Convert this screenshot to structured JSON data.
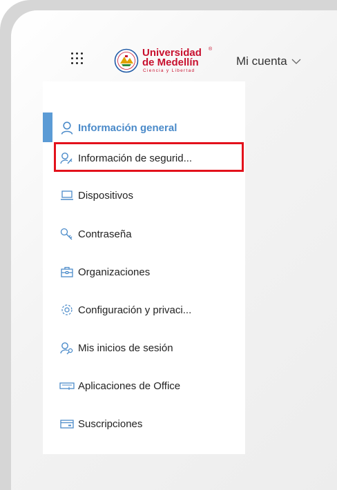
{
  "header": {
    "logo": {
      "line1": "Universidad",
      "line2": "de Medellín",
      "registered": "®",
      "tagline": "Ciencia y Libertad"
    },
    "account_label": "Mi cuenta"
  },
  "nav": {
    "items": [
      {
        "label": "Información general",
        "icon": "person-icon",
        "active": true
      },
      {
        "label": "Información de segurid...",
        "icon": "person-key-icon",
        "highlighted": true
      },
      {
        "label": "Dispositivos",
        "icon": "laptop-icon"
      },
      {
        "label": "Contraseña",
        "icon": "key-icon"
      },
      {
        "label": "Organizaciones",
        "icon": "briefcase-icon"
      },
      {
        "label": "Configuración y privaci...",
        "icon": "gear-icon"
      },
      {
        "label": "Mis inicios de sesión",
        "icon": "person-key-icon"
      },
      {
        "label": "Aplicaciones de Office",
        "icon": "keyboard-icon"
      },
      {
        "label": "Suscripciones",
        "icon": "card-icon"
      }
    ]
  },
  "colors": {
    "accent": "#5b9bd5",
    "highlight": "#e3111b",
    "brand": "#c8102e"
  }
}
